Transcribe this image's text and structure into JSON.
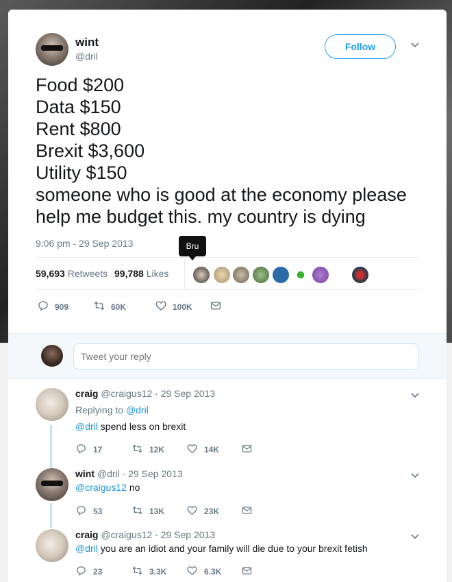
{
  "tweet": {
    "author_name": "wint",
    "author_handle": "@dril",
    "follow_label": "Follow",
    "text_lines": [
      "Food $200",
      "Data $150",
      "Rent $800",
      "Brexit $3,600",
      "Utility $150",
      "someone who is good at the economy please",
      "help me budget this. my country is dying"
    ],
    "timestamp": "9:06 pm - 29 Sep 2013",
    "retweets_count": "59,693",
    "retweets_label": "Retweets",
    "likes_count": "99,788",
    "likes_label": "Likes",
    "tooltip": "Bru",
    "actions": {
      "replies": "909",
      "retweets": "60K",
      "likes": "100K"
    }
  },
  "reply_box": {
    "placeholder": "Tweet your reply"
  },
  "replies": [
    {
      "name": "craig",
      "handle": "@craigus12",
      "date": "· 29 Sep 2013",
      "replying_label": "Replying to",
      "replying_to": "@dril",
      "mention": "@dril",
      "text": "spend less on brexit",
      "replies": "17",
      "retweets": "12K",
      "likes": "14K"
    },
    {
      "name": "wint",
      "handle": "@dril",
      "date": "· 29 Sep 2013",
      "mention": "@craigus12",
      "text": "no",
      "replies": "53",
      "retweets": "13K",
      "likes": "23K"
    },
    {
      "name": "craig",
      "handle": "@craigus12",
      "date": "· 29 Sep 2013",
      "mention": "@dril",
      "text": "you are an idiot and your family will die due to your brexit fetish",
      "replies": "23",
      "retweets": "3.3K",
      "likes": "6.3K"
    }
  ],
  "colors": {
    "accent": "#1da1f2",
    "mention": "#1b95e0",
    "muted": "#657786",
    "text": "#14171a"
  },
  "icons": [
    "reply-icon",
    "retweet-icon",
    "heart-icon",
    "mail-icon",
    "chevron-down-icon"
  ]
}
